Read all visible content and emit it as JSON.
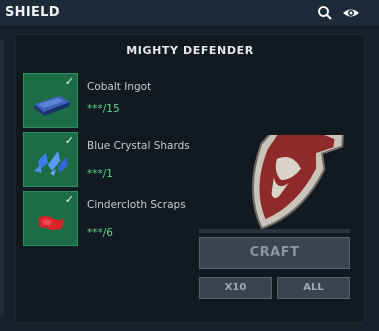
{
  "header": {
    "title": "SHIELD",
    "icons": [
      "search-icon",
      "eye-icon"
    ]
  },
  "recipe": {
    "item_name": "MIGHTY DEFENDER",
    "ingredients": [
      {
        "name": "Cobalt Ingot",
        "count": "***/15",
        "icon": "cobalt-ingot-icon",
        "checked": true
      },
      {
        "name": "Blue Crystal Shards",
        "count": "***/1",
        "icon": "blue-crystal-shards-icon",
        "checked": true
      },
      {
        "name": "Cindercloth Scraps",
        "count": "***/6",
        "icon": "cindercloth-scraps-icon",
        "checked": true
      }
    ],
    "check_glyph": "✓"
  },
  "actions": {
    "craft_label": "CRAFT",
    "x10_label": "X10",
    "all_label": "ALL"
  },
  "colors": {
    "slot_green": "#1c6d45",
    "count_green": "#5ed68c",
    "shield_red": "#8e2a2a"
  }
}
